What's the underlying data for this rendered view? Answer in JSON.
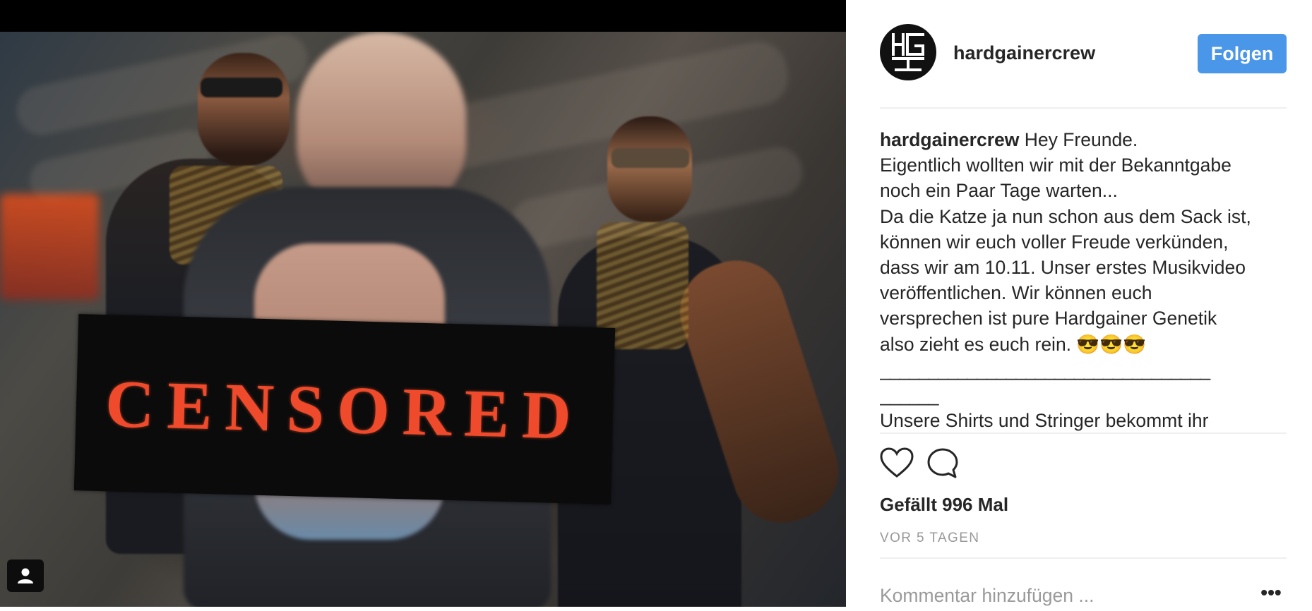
{
  "post": {
    "username": "hardgainercrew",
    "follow_label": "Folgen",
    "image_overlay_text": "CENSORED",
    "caption_lines": [
      "Hey Freunde.",
      "Eigentlich wollten wir mit der Bekanntgabe",
      "noch ein Paar Tage warten...",
      "Da die Katze ja nun schon aus dem Sack ist,",
      "können wir euch voller Freude verkünden,",
      "dass wir am 10.11. Unser erstes Musikvideo",
      "veröffentlichen. Wir können euch",
      "versprechen ist pure Hardgainer Genetik",
      "also zieht es euch rein. 😎😎😎",
      "__________________________________",
      "______",
      "Unsere Shirts und Stringer bekommt ihr"
    ],
    "likes_text": "Gefällt 996 Mal",
    "timestamp": "VOR 5 TAGEN",
    "comment_placeholder": "Kommentar hinzufügen ...",
    "more_label": "•••"
  },
  "icons": {
    "like": "heart-outline-icon",
    "comment": "speech-bubble-icon",
    "user_tag": "user-silhouette-icon"
  },
  "colors": {
    "follow_button": "#4a96e8",
    "censor_text": "#f04a2c",
    "muted_text": "#999999"
  }
}
